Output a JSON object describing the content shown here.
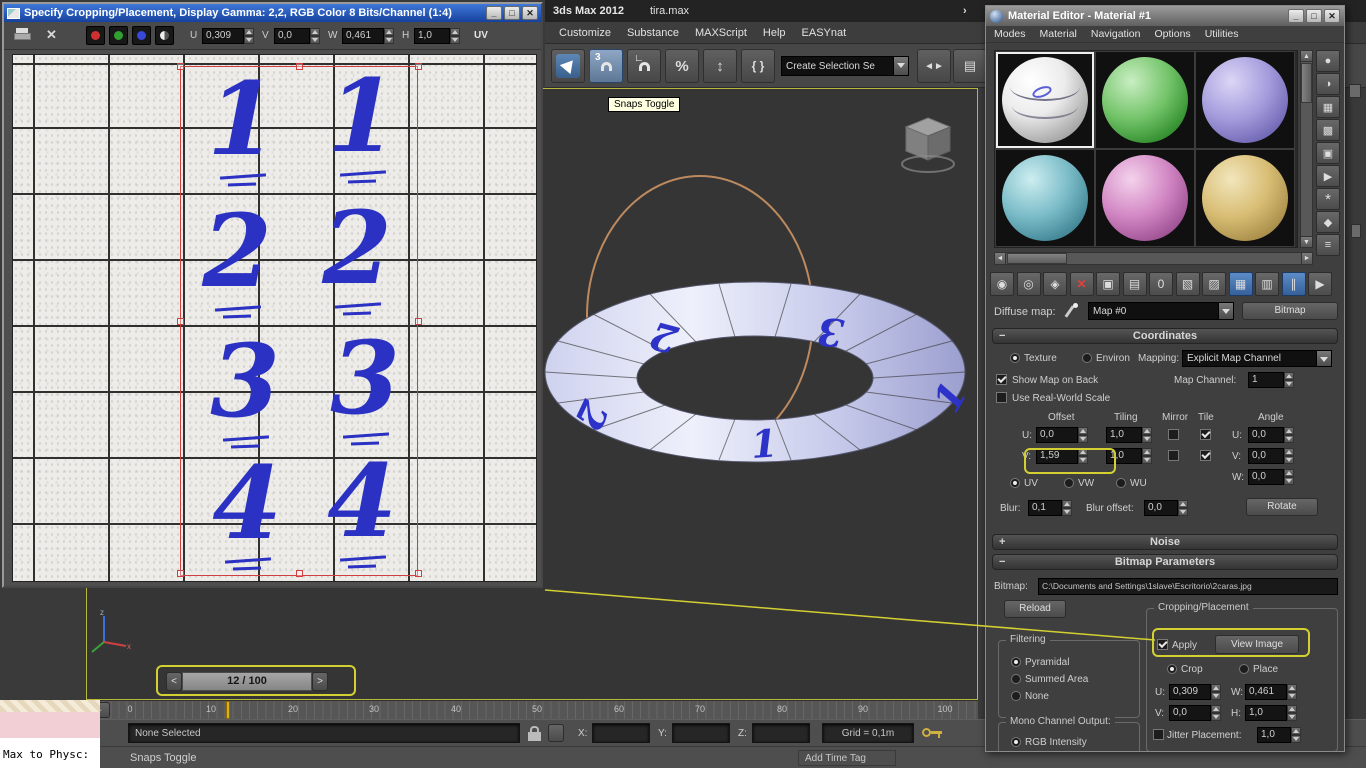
{
  "window_controls": {
    "minimize": "_",
    "maximize": "□",
    "close": "✕"
  },
  "collapse": {
    "expanded": "−",
    "collapsed": "+"
  },
  "arrows": {
    "left": "◄",
    "right": "►",
    "up": "▲",
    "down": "▼",
    "overflow": "›"
  },
  "crop_window": {
    "title": "Specify Cropping/Placement, Display Gamma: 2,2, RGB Color 8 Bits/Channel (1:4)",
    "toolbar": {
      "u_label": "U",
      "u_value": "0,309",
      "v_label": "V",
      "v_value": "0,0",
      "w_label": "W",
      "w_value": "0,461",
      "h_label": "H",
      "h_value": "1,0",
      "uv_label": "UV"
    },
    "numbers": [
      "1",
      "1",
      "2",
      "2",
      "3",
      "3",
      "4",
      "4"
    ]
  },
  "max_window": {
    "app_title": "3ds Max  2012",
    "file_title": "tira.max",
    "menus": [
      "Customize",
      "Substance",
      "MAXScript",
      "Help",
      "EASYnat"
    ],
    "toolbar": {
      "snap_number": "3",
      "angle_glyph": "∟",
      "percent_glyph": "%",
      "spinner_glyph": "↕",
      "script_glyph": "{ }",
      "selection_dropdown": "Create Selection Se",
      "mirror_glyph": "◄►",
      "align_glyph": "▤"
    },
    "tooltip": "Snaps Toggle"
  },
  "viewport": {
    "strip_numbers": [
      "2",
      "3",
      "2",
      "1",
      "1"
    ]
  },
  "timeline": {
    "frame_display": "12 / 100",
    "prev_label": "<",
    "next_label": ">",
    "ticks": [
      "0",
      "10",
      "20",
      "30",
      "40",
      "50",
      "60",
      "70",
      "80",
      "90",
      "100"
    ]
  },
  "status_bar": {
    "selection": "None Selected",
    "x_label": "X:",
    "y_label": "Y:",
    "z_label": "Z:",
    "grid_label": "Grid = 0,1m",
    "prompt": "Snaps Toggle",
    "add_time_tag": "Add Time Tag",
    "listener_button": "Max to Physc:"
  },
  "material_editor": {
    "title": "Material Editor - Material #1",
    "menus": [
      "Modes",
      "Material",
      "Navigation",
      "Options",
      "Utilities"
    ],
    "side_tools": [
      {
        "name": "sample-type",
        "glyph": "●"
      },
      {
        "name": "backlight",
        "glyph": "◑"
      },
      {
        "name": "background",
        "glyph": "▦"
      },
      {
        "name": "sample-uv-tiling",
        "glyph": "▩"
      },
      {
        "name": "video-color-check",
        "glyph": "▣"
      },
      {
        "name": "make-preview",
        "glyph": "▶"
      },
      {
        "name": "options",
        "glyph": "*"
      },
      {
        "name": "select-by-material",
        "glyph": "◆"
      },
      {
        "name": "material-map-navigator",
        "glyph": "≡"
      }
    ],
    "toolbar_icons": [
      {
        "name": "get-material",
        "glyph": "◉"
      },
      {
        "name": "put-material-to-scene",
        "glyph": "◎"
      },
      {
        "name": "assign-material-to-selection",
        "glyph": "◈"
      },
      {
        "name": "reset-map",
        "glyph": "✕"
      },
      {
        "name": "make-material-copy",
        "glyph": "▣"
      },
      {
        "name": "put-to-library",
        "glyph": "▤"
      },
      {
        "name": "material-id-channel",
        "glyph": "0"
      },
      {
        "name": "show-background",
        "glyph": "▧"
      },
      {
        "name": "show-standard-map",
        "glyph": "▨"
      },
      {
        "name": "show-map-in-viewport",
        "glyph": "▦"
      },
      {
        "name": "show-end-result",
        "glyph": "▥"
      },
      {
        "name": "go-to-parent",
        "glyph": "∥"
      },
      {
        "name": "go-forward-to-sibling",
        "glyph": "▶"
      }
    ],
    "diffuse_label": "Diffuse map:",
    "map_name": "Map #0",
    "bitmap_type_button": "Bitmap",
    "coordinates": {
      "header": "Coordinates",
      "texture_label": "Texture",
      "environ_label": "Environ",
      "mapping_label": "Mapping:",
      "mapping_value": "Explicit Map Channel",
      "show_map_on_back": "Show Map on Back",
      "map_channel_label": "Map Channel:",
      "map_channel_value": "1",
      "use_real_world": "Use Real-World Scale",
      "offset_header": "Offset",
      "tiling_header": "Tiling",
      "mirror_header": "Mirror",
      "tile_header": "Tile",
      "angle_header": "Angle",
      "u_label": "U:",
      "v_label": "V:",
      "w_label": "W:",
      "u_offset": "0,0",
      "u_tiling": "1,0",
      "u_angle": "0,0",
      "v_offset": "1,59",
      "v_tiling": "1,0",
      "v_angle": "0,0",
      "w_angle": "0,0",
      "uv_label": "UV",
      "vw_label": "VW",
      "wu_label": "WU",
      "blur_label": "Blur:",
      "blur_value": "0,1",
      "blur_offset_label": "Blur offset:",
      "blur_offset_value": "0,0",
      "rotate_button": "Rotate"
    },
    "noise_header": "Noise",
    "bitmap_parameters": {
      "header": "Bitmap Parameters",
      "bitmap_label": "Bitmap:",
      "bitmap_path": "C:\\Documents and Settings\\1slave\\Escritorio\\2caras.jpg",
      "reload_button": "Reload",
      "cropping_group_label": "Cropping/Placement",
      "apply_label": "Apply",
      "view_image_button": "View Image",
      "crop_label": "Crop",
      "place_label": "Place",
      "u_label": "U:",
      "u_value": "0,309",
      "w_label": "W:",
      "w_value": "0,461",
      "v_label": "V:",
      "v_value": "0,0",
      "h_label": "H:",
      "h_value": "1,0",
      "jitter_label": "Jitter Placement:",
      "jitter_value": "1,0",
      "filtering_group_label": "Filtering",
      "filter_pyramidal": "Pyramidal",
      "filter_summed": "Summed Area",
      "filter_none": "None",
      "mono_group_label": "Mono Channel Output:",
      "mono_rgb": "RGB Intensity"
    }
  }
}
